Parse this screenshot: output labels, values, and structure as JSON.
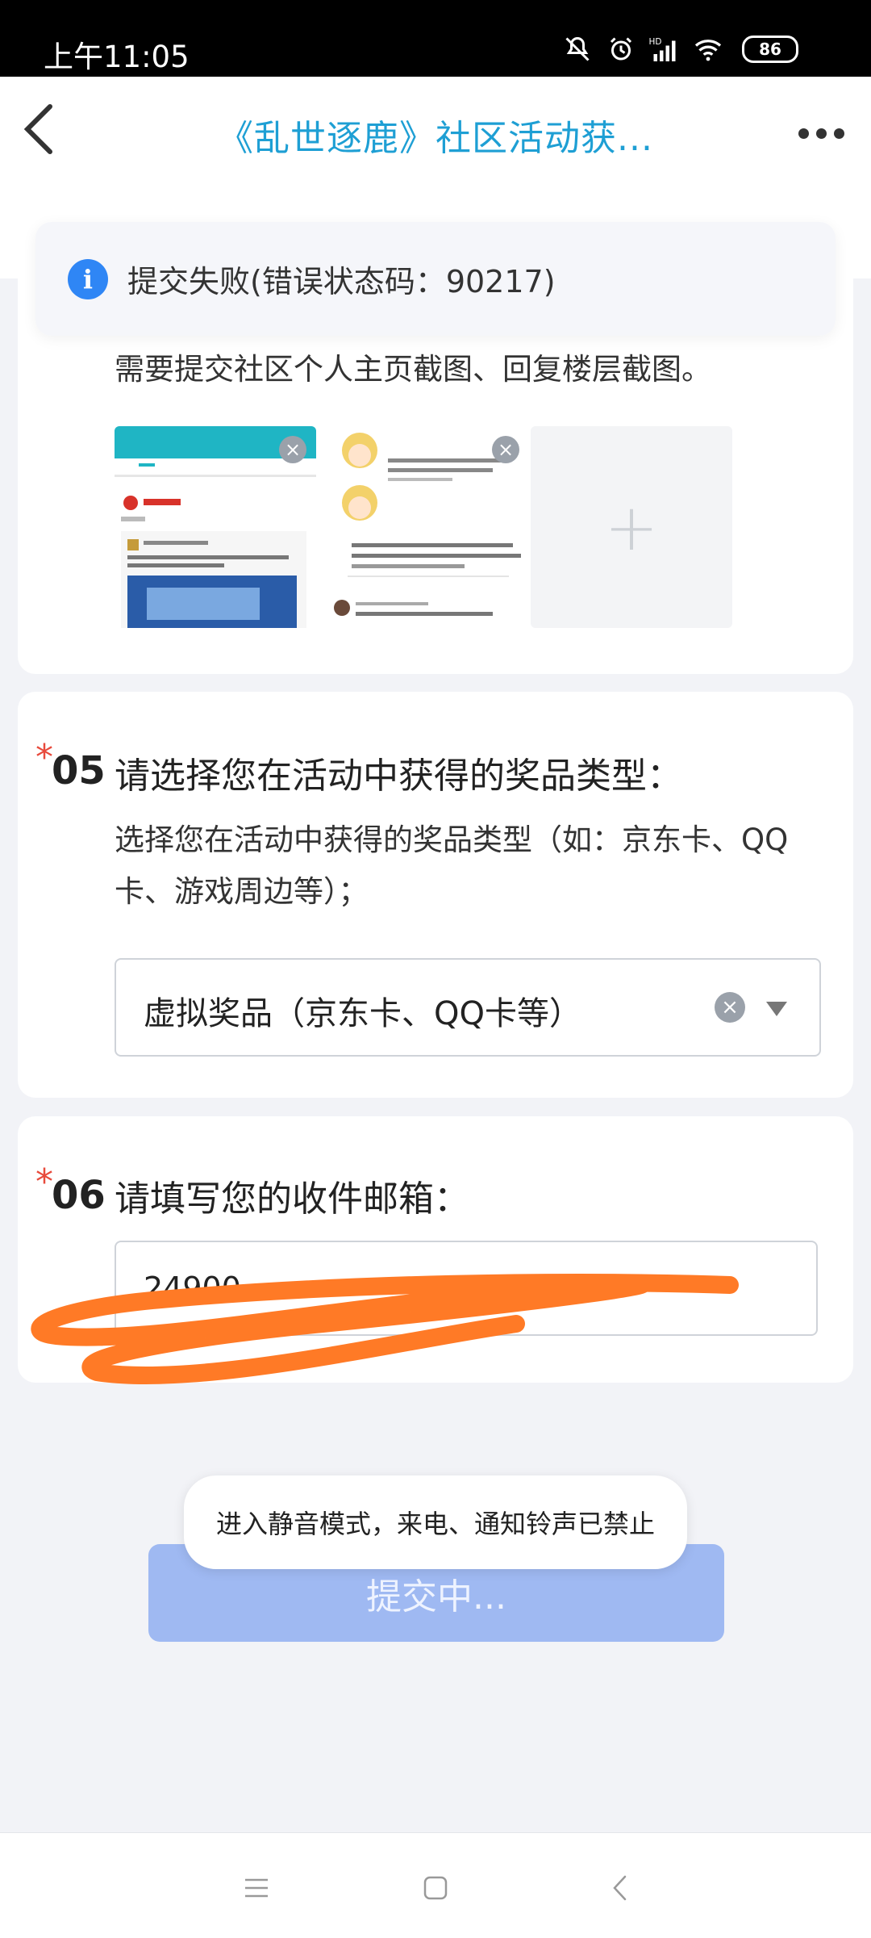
{
  "status_bar": {
    "time": "上午11:05",
    "battery": "86",
    "icons": [
      "mute-icon",
      "alarm-icon",
      "signal-icon",
      "wifi-icon",
      "battery-icon"
    ]
  },
  "header": {
    "title": "《乱世逐鹿》社区活动获..."
  },
  "toast_error": {
    "text": "提交失败(错误状态码：90217)"
  },
  "question_04": {
    "hint": "需要提交社区个人主页截图、回复楼层截图。"
  },
  "question_05": {
    "number": "05",
    "required_mark": "*",
    "title": "请选择您在活动中获得的奖品类型：",
    "description": "选择您在活动中获得的奖品类型（如：京东卡、QQ卡、游戏周边等）；",
    "selected_value": "虚拟奖品（京东卡、QQ卡等）"
  },
  "question_06": {
    "number": "06",
    "required_mark": "*",
    "title": "请填写您的收件邮箱：",
    "input_value": "24900"
  },
  "submit": {
    "label": "提交中..."
  },
  "toast_silent": {
    "text": "进入静音模式，来电、通知铃声已禁止"
  },
  "colors": {
    "title_blue": "#1e9fd4",
    "info_blue": "#2f86f5",
    "required_red": "#e84a3c",
    "submit_disabled": "#9fb9f2",
    "scribble_orange": "#ff7a26"
  }
}
